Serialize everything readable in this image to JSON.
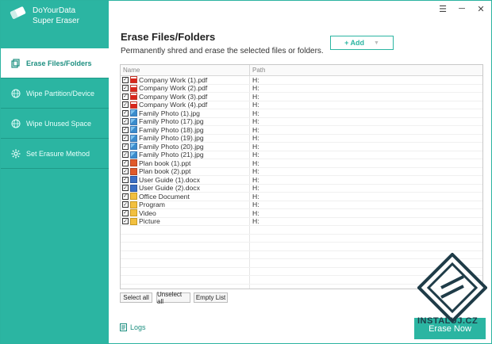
{
  "app": {
    "brand_line1": "DoYourData",
    "brand_line2": "Super Eraser",
    "accent": "#2bb5a2"
  },
  "window_controls": {
    "menu": "☰",
    "minimize": "─",
    "close": "✕"
  },
  "sidebar": {
    "items": [
      {
        "label": "Erase Files/Folders",
        "icon": "copy-files-icon",
        "active": true
      },
      {
        "label": "Wipe Partition/Device",
        "icon": "globe-icon",
        "active": false
      },
      {
        "label": "Wipe Unused Space",
        "icon": "globe-icon",
        "active": false
      },
      {
        "label": "Set Erasure Method",
        "icon": "gear-icon",
        "active": false
      }
    ]
  },
  "main": {
    "title": "Erase Files/Folders",
    "subtitle": "Permanently shred and erase the selected files or folders.",
    "add_label": "+ Add",
    "columns": {
      "name": "Name",
      "path": "Path"
    },
    "rows": [
      {
        "name": "Company Work (1).pdf",
        "path": "H:",
        "type": "pdf"
      },
      {
        "name": "Company Work (2).pdf",
        "path": "H:",
        "type": "pdf"
      },
      {
        "name": "Company Work (3).pdf",
        "path": "H:",
        "type": "pdf"
      },
      {
        "name": "Company Work (4).pdf",
        "path": "H:",
        "type": "pdf"
      },
      {
        "name": "Family Photo (1).jpg",
        "path": "H:",
        "type": "jpg"
      },
      {
        "name": "Family Photo (17).jpg",
        "path": "H:",
        "type": "jpg"
      },
      {
        "name": "Family Photo (18).jpg",
        "path": "H:",
        "type": "jpg"
      },
      {
        "name": "Family Photo (19).jpg",
        "path": "H:",
        "type": "jpg"
      },
      {
        "name": "Family Photo (20).jpg",
        "path": "H:",
        "type": "jpg"
      },
      {
        "name": "Family Photo (21).jpg",
        "path": "H:",
        "type": "jpg"
      },
      {
        "name": "Plan book (1).ppt",
        "path": "H:",
        "type": "ppt"
      },
      {
        "name": "Plan book (2).ppt",
        "path": "H:",
        "type": "ppt"
      },
      {
        "name": "User Guide (1).docx",
        "path": "H:",
        "type": "docx"
      },
      {
        "name": "User Guide (2).docx",
        "path": "H:",
        "type": "docx"
      },
      {
        "name": "Office Document",
        "path": "H:",
        "type": "folder"
      },
      {
        "name": "Program",
        "path": "H:",
        "type": "folder"
      },
      {
        "name": "Video",
        "path": "H:",
        "type": "folder"
      },
      {
        "name": "Picture",
        "path": "H:",
        "type": "folder"
      }
    ],
    "empty_rows": 8,
    "select_all": "Select all",
    "unselect_all": "Unselect all",
    "empty_list": "Empty List",
    "logs_label": "Logs",
    "erase_label": "Erase Now"
  },
  "watermark": {
    "text": "INSTALUJ.CZ"
  }
}
